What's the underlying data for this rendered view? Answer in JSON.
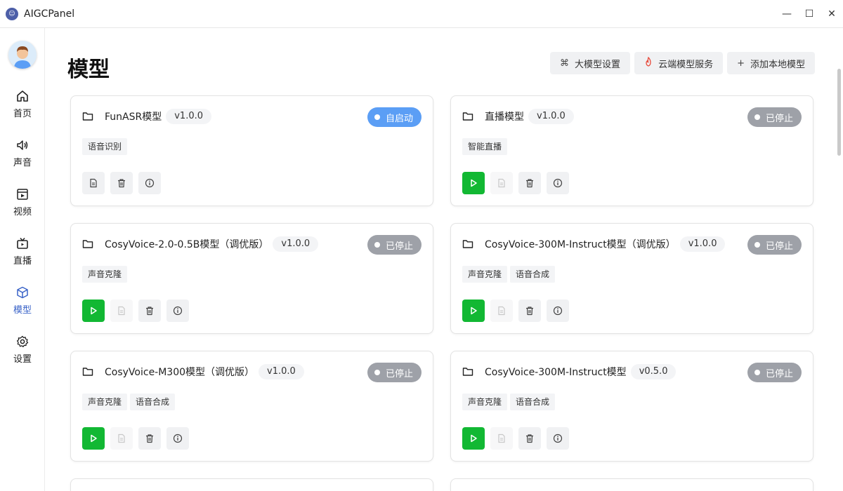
{
  "app": {
    "title": "AIGCPanel"
  },
  "window": {
    "minimize": "—",
    "maximize": "☐",
    "close": "✕"
  },
  "sidebar": {
    "items": [
      {
        "label": "首页",
        "icon": "home-icon"
      },
      {
        "label": "声音",
        "icon": "speaker-icon"
      },
      {
        "label": "视频",
        "icon": "video-icon"
      },
      {
        "label": "直播",
        "icon": "tv-icon"
      },
      {
        "label": "模型",
        "icon": "cube-icon",
        "active": true
      },
      {
        "label": "设置",
        "icon": "gear-icon"
      }
    ]
  },
  "page": {
    "title": "模型",
    "actions": [
      {
        "label": "大模型设置",
        "icon": "⌘"
      },
      {
        "label": "云端模型服务",
        "icon": "🔥"
      },
      {
        "label": "添加本地模型",
        "icon": "+"
      }
    ]
  },
  "models": [
    {
      "name": "FunASR模型",
      "version": "v1.0.0",
      "status": "自启动",
      "status_type": "autostart",
      "tags": [
        "语音识别"
      ],
      "show_play": false
    },
    {
      "name": "直播模型",
      "version": "v1.0.0",
      "status": "已停止",
      "status_type": "stopped",
      "tags": [
        "智能直播"
      ],
      "show_play": true
    },
    {
      "name": "CosyVoice-2.0-0.5B模型（调优版）",
      "version": "v1.0.0",
      "status": "已停止",
      "status_type": "stopped",
      "tags": [
        "声音克隆"
      ],
      "show_play": true
    },
    {
      "name": "CosyVoice-300M-Instruct模型（调优版）",
      "version": "v1.0.0",
      "status": "已停止",
      "status_type": "stopped",
      "tags": [
        "声音克隆",
        "语音合成"
      ],
      "show_play": true
    },
    {
      "name": "CosyVoice-M300模型（调优版）",
      "version": "v1.0.0",
      "status": "已停止",
      "status_type": "stopped",
      "tags": [
        "声音克隆",
        "语音合成"
      ],
      "show_play": true
    },
    {
      "name": "CosyVoice-300M-Instruct模型",
      "version": "v0.5.0",
      "status": "已停止",
      "status_type": "stopped",
      "tags": [
        "声音克隆",
        "语音合成"
      ],
      "show_play": true
    }
  ],
  "colors": {
    "accent": "#3a63c8",
    "play": "#12b833",
    "autostart": "#5b9ef5",
    "stopped": "#9ea1a8"
  }
}
